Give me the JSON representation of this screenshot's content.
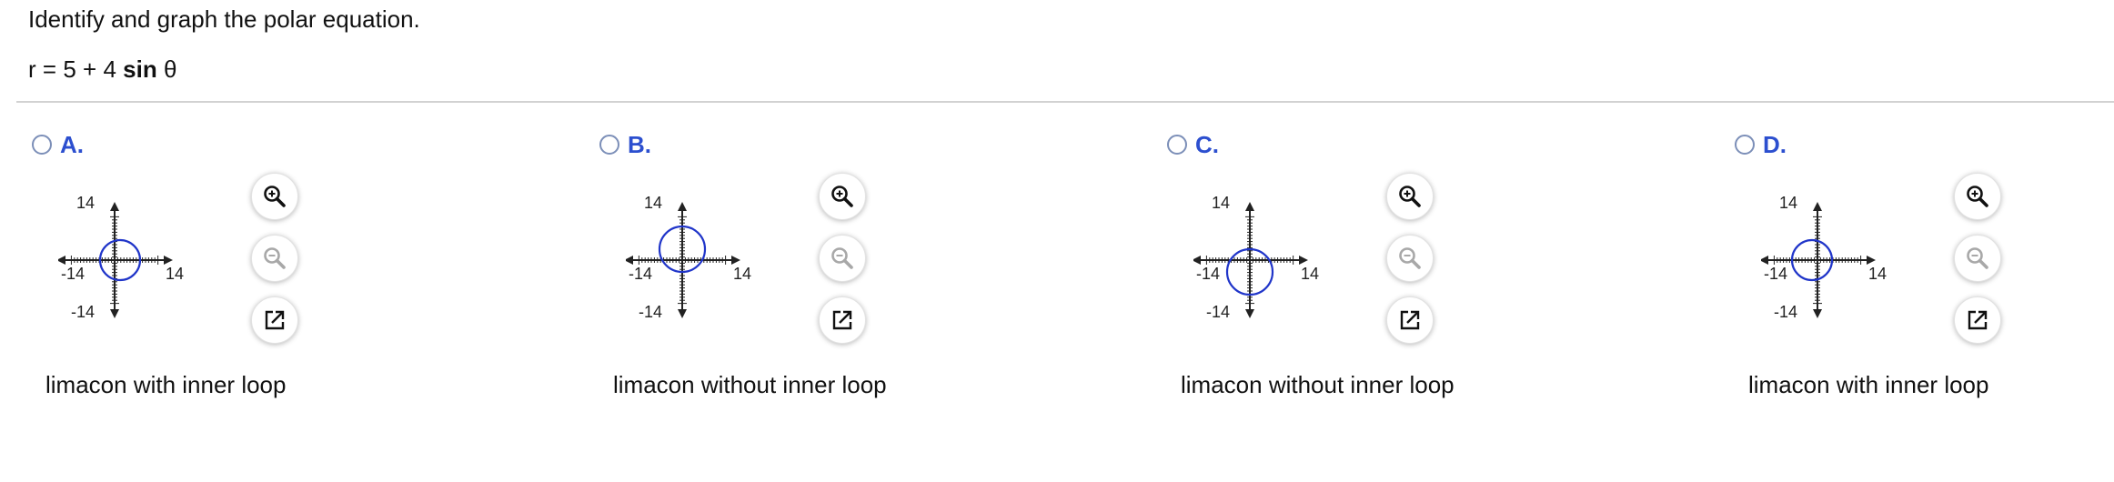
{
  "question": "Identify and graph the polar equation.",
  "equation": {
    "lhs": "r",
    "eq": "=",
    "const": "5",
    "plus": "+",
    "coef": "4",
    "fn": "sin",
    "var": "θ"
  },
  "colors": {
    "curve": "#2035c9",
    "axis": "#222222",
    "letter": "#2c4fcf"
  },
  "options": [
    {
      "letter": "A.",
      "label": "limacon with inner loop",
      "ticks": {
        "y_pos": "14",
        "y_neg": "-14",
        "x_pos": "14",
        "x_neg": "-14"
      },
      "curve": "circle-right"
    },
    {
      "letter": "B.",
      "label": "limacon without inner loop",
      "ticks": {
        "y_pos": "14",
        "y_neg": "-14",
        "x_pos": "14",
        "x_neg": "-14"
      },
      "curve": "circle-top"
    },
    {
      "letter": "C.",
      "label": "limacon without inner loop",
      "ticks": {
        "y_pos": "14",
        "y_neg": "-14",
        "x_pos": "14",
        "x_neg": "-14"
      },
      "curve": "circle-bottom"
    },
    {
      "letter": "D.",
      "label": "limacon with inner loop",
      "ticks": {
        "y_pos": "14",
        "y_neg": "-14",
        "x_pos": "14",
        "x_neg": "-14"
      },
      "curve": "circle-left"
    }
  ],
  "tool_icons": [
    "zoom-in-icon",
    "zoom-out-icon",
    "popout-icon"
  ]
}
